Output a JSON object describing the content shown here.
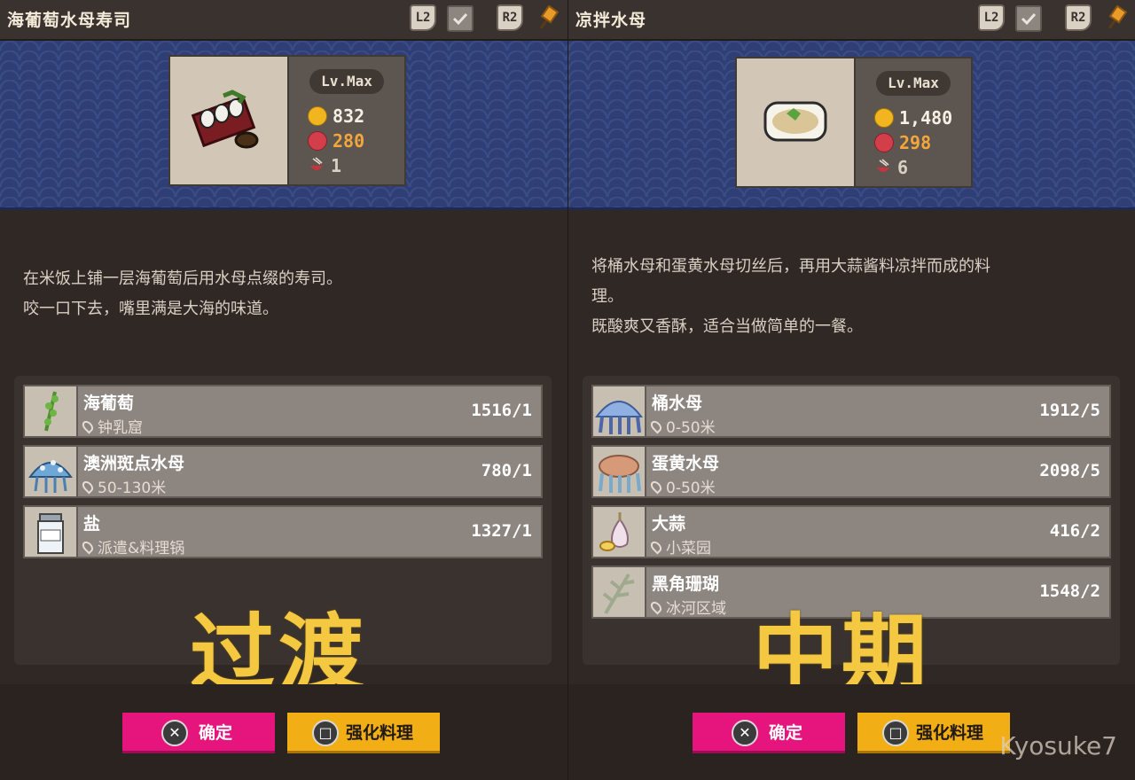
{
  "left": {
    "title": "海葡萄水母寿司",
    "l2": "L2",
    "r2": "R2",
    "level": "Lv.Max",
    "price": "832",
    "flavor": "280",
    "count": "1",
    "description": [
      "在米饭上铺一层海葡萄后用水母点缀的寿司。",
      "咬一口下去，嘴里满是大海的味道。"
    ],
    "ingredients": [
      {
        "name": "海葡萄",
        "location": "钟乳窟",
        "qty": "1516/1",
        "icon": "sea-grape-icon"
      },
      {
        "name": "澳洲斑点水母",
        "location": "50-130米",
        "qty": "780/1",
        "icon": "spotted-jellyfish-icon"
      },
      {
        "name": "盐",
        "location": "派遣&料理锅",
        "qty": "1327/1",
        "icon": "salt-icon"
      }
    ],
    "overlay": "过渡",
    "confirm_label": "确定",
    "enhance_label": "强化料理"
  },
  "right": {
    "title": "凉拌水母",
    "l2": "L2",
    "r2": "R2",
    "level": "Lv.Max",
    "price": "1,480",
    "flavor": "298",
    "count": "6",
    "description": [
      "将桶水母和蛋黄水母切丝后，再用大蒜酱料凉拌而成的料",
      "理。",
      "既酸爽又香酥，适合当做简单的一餐。"
    ],
    "ingredients": [
      {
        "name": "桶水母",
        "location": "0-50米",
        "qty": "1912/5",
        "icon": "barrel-jellyfish-icon"
      },
      {
        "name": "蛋黄水母",
        "location": "0-50米",
        "qty": "2098/5",
        "icon": "egg-yolk-jellyfish-icon"
      },
      {
        "name": "大蒜",
        "location": "小菜园",
        "qty": "416/2",
        "icon": "garlic-icon"
      },
      {
        "name": "黑角珊瑚",
        "location": "冰河区域",
        "qty": "1548/2",
        "icon": "black-coral-icon"
      }
    ],
    "overlay": "中期",
    "confirm_label": "确定",
    "enhance_label": "强化料理"
  },
  "watermark": "Kyosuke7",
  "colors": {
    "confirm": "#e6157e",
    "enhance": "#f2ae15",
    "overlay": "#f5c842",
    "banner": "#2f3f75"
  }
}
